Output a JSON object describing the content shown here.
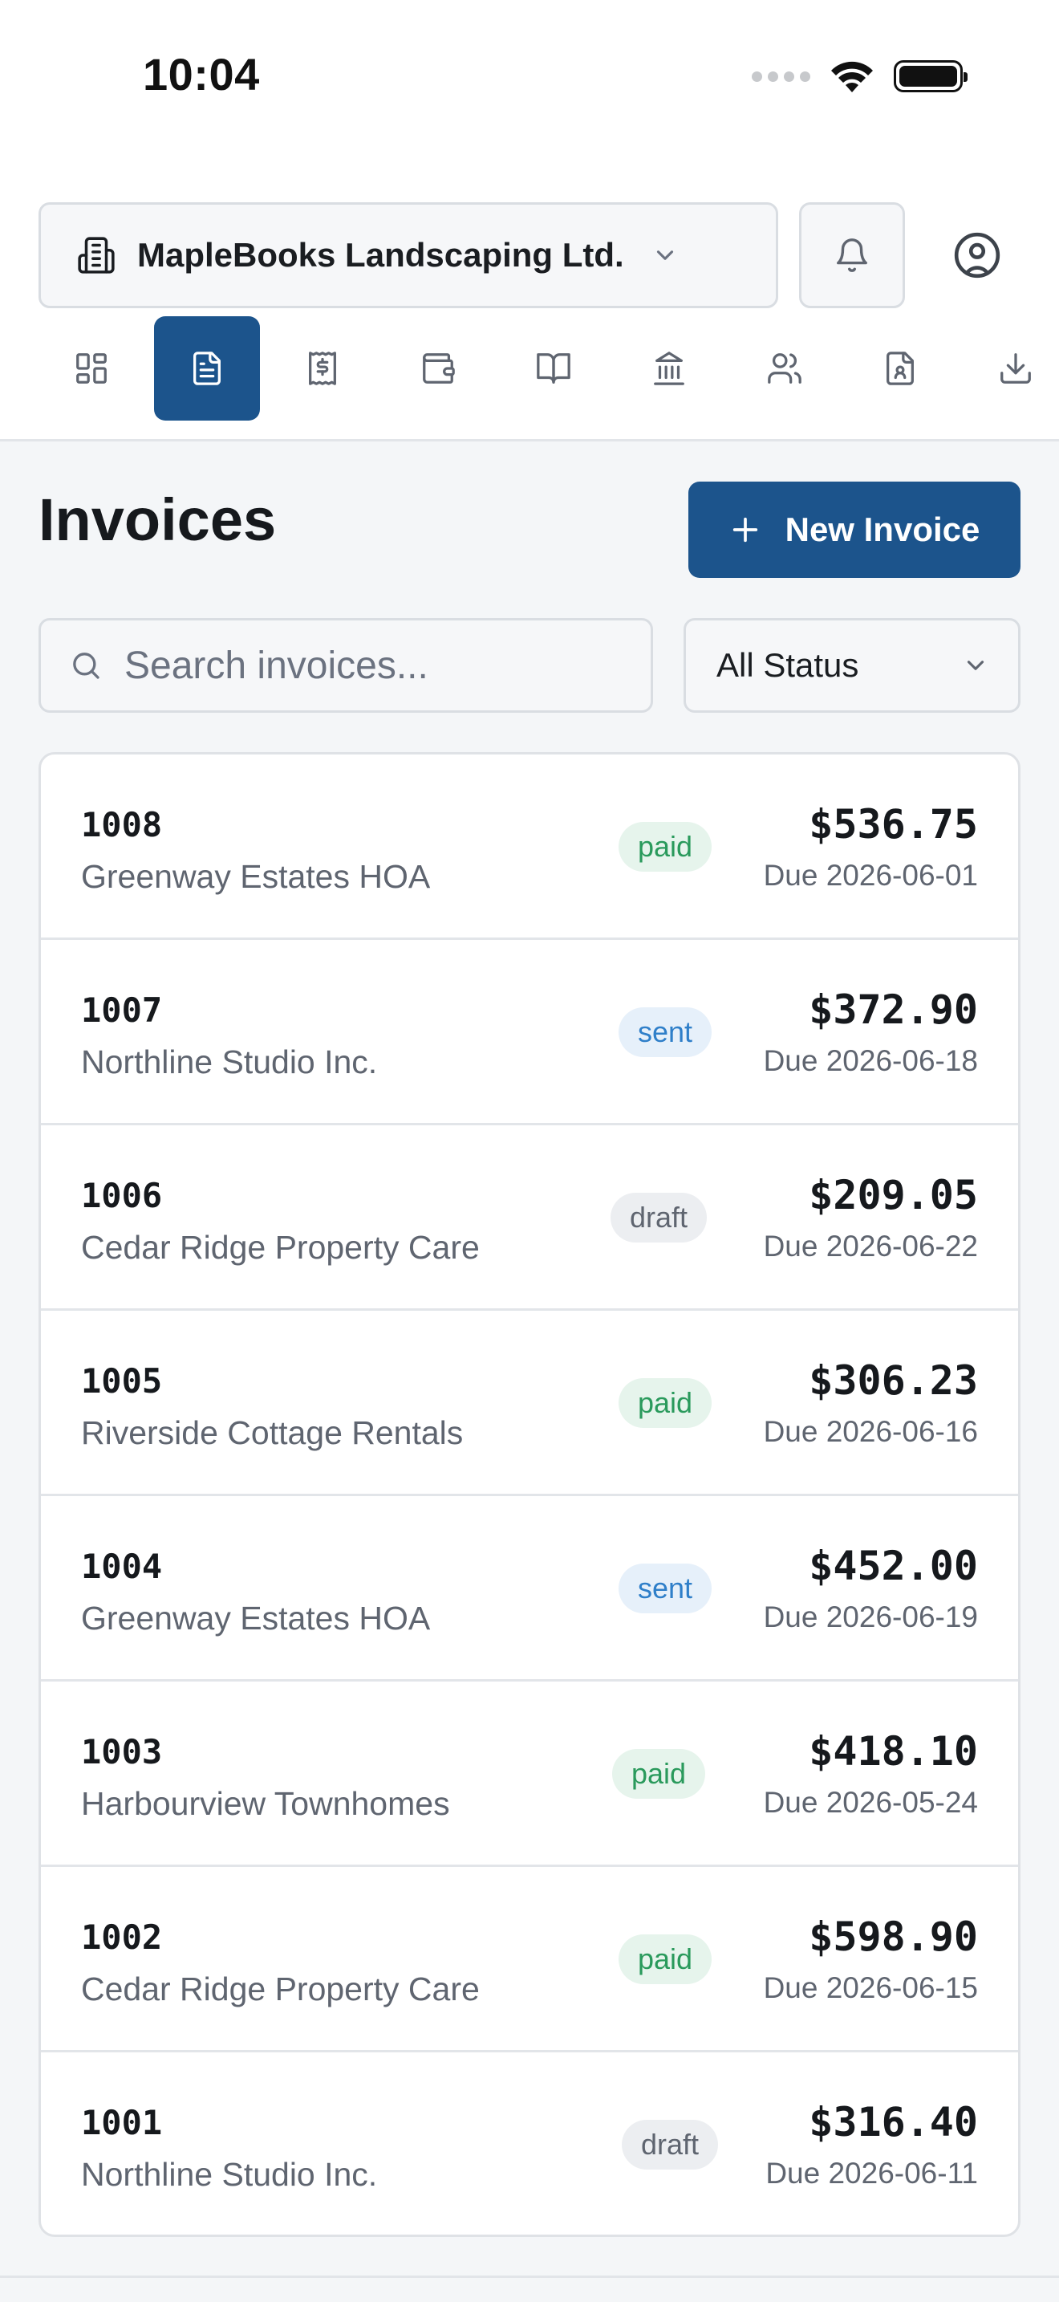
{
  "status_bar": {
    "time": "10:04"
  },
  "header": {
    "company": "MapleBooks Landscaping Ltd."
  },
  "nav": [
    {
      "icon": "dashboard-icon",
      "active": false
    },
    {
      "icon": "document-icon",
      "active": true
    },
    {
      "icon": "receipt-dollar-icon",
      "active": false
    },
    {
      "icon": "wallet-icon",
      "active": false
    },
    {
      "icon": "book-open-icon",
      "active": false
    },
    {
      "icon": "bank-icon",
      "active": false
    },
    {
      "icon": "users-icon",
      "active": false
    },
    {
      "icon": "file-user-icon",
      "active": false
    },
    {
      "icon": "download-icon",
      "active": false
    }
  ],
  "page": {
    "title": "Invoices",
    "new_button": "New Invoice",
    "search_placeholder": "Search invoices...",
    "status_filter": "All Status"
  },
  "invoices": [
    {
      "number": "1008",
      "client": "Greenway Estates HOA",
      "status": "paid",
      "amount": "$536.75",
      "due": "Due 2026-06-01"
    },
    {
      "number": "1007",
      "client": "Northline Studio Inc.",
      "status": "sent",
      "amount": "$372.90",
      "due": "Due 2026-06-18"
    },
    {
      "number": "1006",
      "client": "Cedar Ridge Property Care",
      "status": "draft",
      "amount": "$209.05",
      "due": "Due 2026-06-22"
    },
    {
      "number": "1005",
      "client": "Riverside Cottage Rentals",
      "status": "paid",
      "amount": "$306.23",
      "due": "Due 2026-06-16"
    },
    {
      "number": "1004",
      "client": "Greenway Estates HOA",
      "status": "sent",
      "amount": "$452.00",
      "due": "Due 2026-06-19"
    },
    {
      "number": "1003",
      "client": "Harbourview Townhomes",
      "status": "paid",
      "amount": "$418.10",
      "due": "Due 2026-05-24"
    },
    {
      "number": "1002",
      "client": "Cedar Ridge Property Care",
      "status": "paid",
      "amount": "$598.90",
      "due": "Due 2026-06-15"
    },
    {
      "number": "1001",
      "client": "Northline Studio Inc.",
      "status": "draft",
      "amount": "$316.40",
      "due": "Due 2026-06-11"
    }
  ],
  "colors": {
    "primary": "#1c548c",
    "paid_bg": "#e6f4ec",
    "paid_fg": "#2a9a5c",
    "sent_bg": "#e6f0fa",
    "sent_fg": "#2f7fc9",
    "draft_bg": "#eceef1",
    "draft_fg": "#5f6570"
  }
}
